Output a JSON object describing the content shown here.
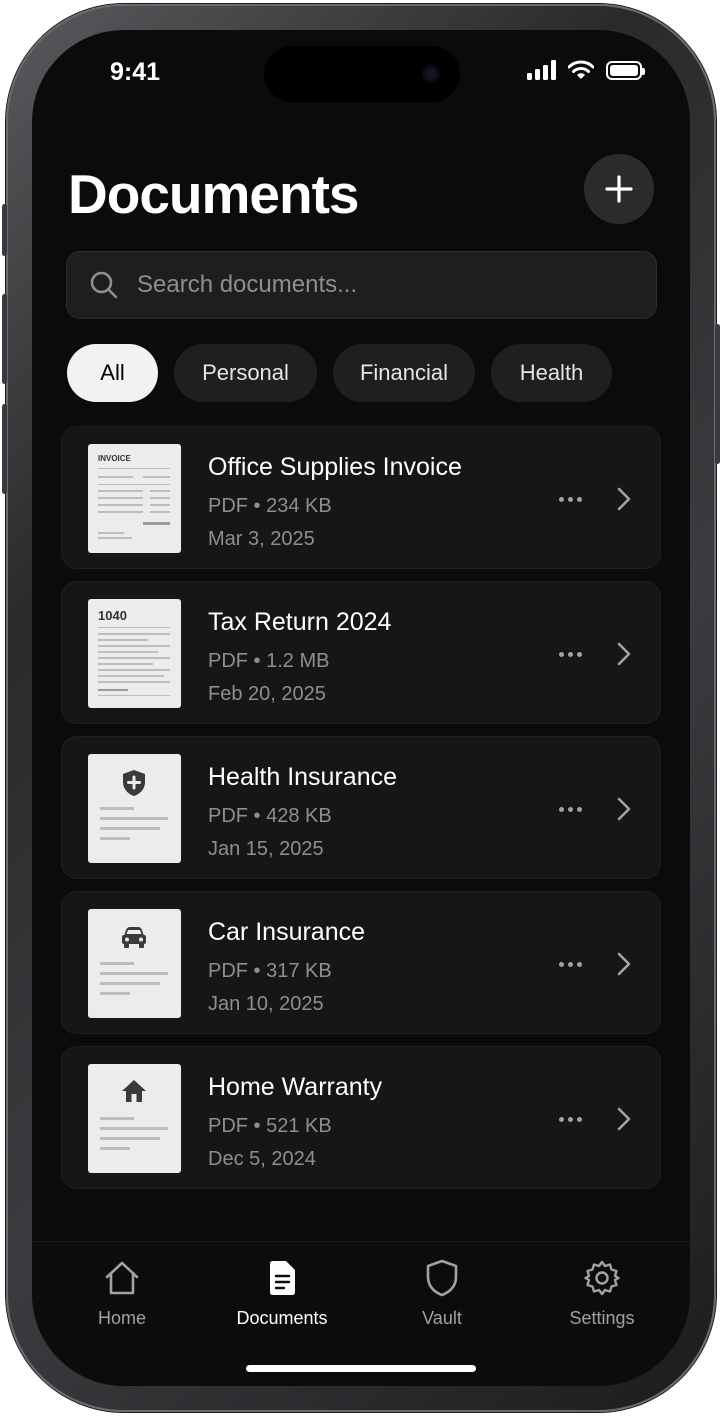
{
  "status_bar": {
    "time": "9:41"
  },
  "header": {
    "title": "Documents",
    "add_icon": "plus-icon"
  },
  "search": {
    "placeholder": "Search documents...",
    "value": "",
    "icon": "search-icon"
  },
  "filters": [
    {
      "label": "All",
      "active": true
    },
    {
      "label": "Personal",
      "active": false
    },
    {
      "label": "Financial",
      "active": false
    },
    {
      "label": "Health",
      "active": false
    }
  ],
  "documents": [
    {
      "name": "Office Supplies Invoice",
      "meta": "PDF • 234 KB",
      "date": "Mar 3, 2025",
      "thumbnail": "invoice-thumbnail",
      "thumbnail_label": "INVOICE"
    },
    {
      "name": "Tax Return 2024",
      "meta": "PDF • 1.2 MB",
      "date": "Feb 20, 2025",
      "thumbnail": "tax-form-thumbnail",
      "thumbnail_label": "1040"
    },
    {
      "name": "Health Insurance",
      "meta": "PDF • 428 KB",
      "date": "Jan 15, 2025",
      "thumbnail": "health-shield-icon"
    },
    {
      "name": "Car Insurance",
      "meta": "PDF • 317 KB",
      "date": "Jan 10, 2025",
      "thumbnail": "car-icon"
    },
    {
      "name": "Home Warranty",
      "meta": "PDF • 521 KB",
      "date": "Dec 5, 2024",
      "thumbnail": "house-icon"
    }
  ],
  "tab_bar": {
    "tabs": [
      {
        "label": "Home",
        "icon": "home-icon",
        "active": false
      },
      {
        "label": "Documents",
        "icon": "document-icon",
        "active": true
      },
      {
        "label": "Vault",
        "icon": "shield-icon",
        "active": false
      },
      {
        "label": "Settings",
        "icon": "gear-icon",
        "active": false
      }
    ]
  },
  "colors": {
    "background": "#0b0b0c",
    "card": "#161617",
    "active_chip": "#f2f2f2",
    "secondary_text": "#8e8e93"
  }
}
